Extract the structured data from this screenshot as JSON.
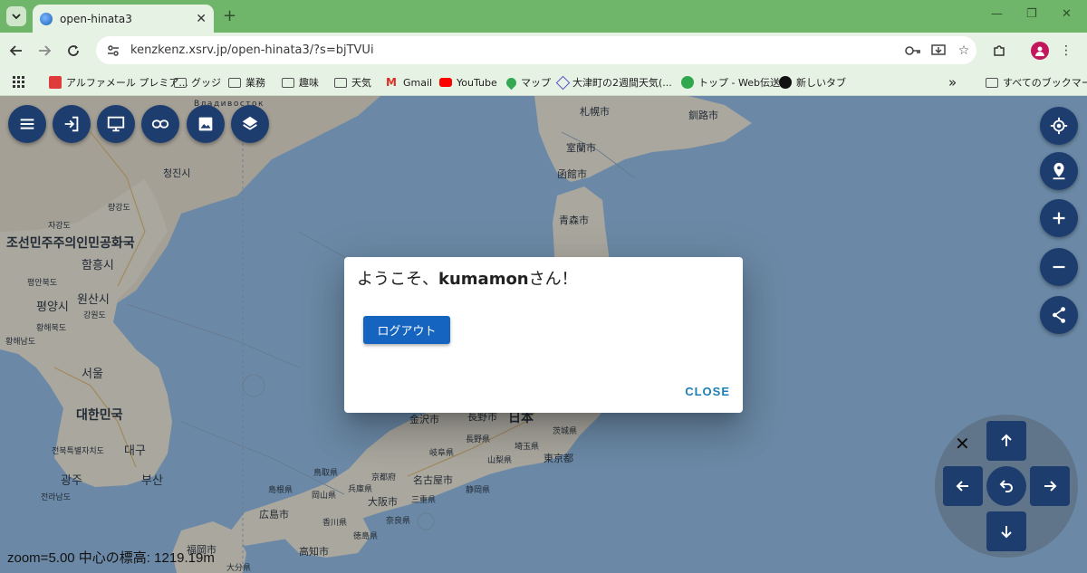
{
  "browser": {
    "tab": {
      "title": "open-hinata3"
    },
    "url": "kenzkenz.xsrv.jp/open-hinata3/?s=bjTVUi",
    "bookmarks": [
      {
        "label": "アルファメール プレミア...",
        "icon": "mail-icon"
      },
      {
        "label": "グッジ",
        "icon": "folder-icon"
      },
      {
        "label": "業務",
        "icon": "folder-icon"
      },
      {
        "label": "趣味",
        "icon": "folder-icon"
      },
      {
        "label": "天気",
        "icon": "folder-icon"
      },
      {
        "label": "Gmail",
        "icon": "gmail-icon"
      },
      {
        "label": "YouTube",
        "icon": "youtube-icon"
      },
      {
        "label": "マップ",
        "icon": "maps-icon"
      },
      {
        "label": "大津町の2週間天気(...",
        "icon": "weather-icon"
      },
      {
        "label": "トップ - Web伝送",
        "icon": "web-icon"
      },
      {
        "label": "新しいタブ",
        "icon": "globe-icon"
      }
    ],
    "more_bookmarks": "»",
    "all_bookmarks": "すべてのブックマーク"
  },
  "map": {
    "labels": {
      "vladivostok": "Владивосток",
      "sapporo": "札幌市",
      "kushiro": "釧路市",
      "muroran": "室蘭市",
      "hakodate": "函館市",
      "aomori": "青森市",
      "qingjin": "청진시",
      "ryanggang": "량강도",
      "jagang": "자강도",
      "dprk": "조선민주주의인민공화국",
      "hamhung": "함흥시",
      "pyongan_n": "평안북도",
      "wonsan": "원산시",
      "pyongyang": "평양시",
      "kangwon": "강원도",
      "hwanghae_s": "황해북도",
      "hwanghae_n": "황해남도",
      "seoul": "서울",
      "rok": "대한민국",
      "jeonbuk": "전북특별자치도",
      "daegu": "대구",
      "gwangju": "광주",
      "busan": "부산",
      "jeonnam": "전라남도",
      "kanazawa": "金沢市",
      "nagano_city": "長野市",
      "japan": "日本",
      "ibaraki": "茨城県",
      "nagano": "長野県",
      "saitama": "埼玉県",
      "gifu": "岐阜県",
      "yamanashi": "山梨県",
      "tokyo": "東京都",
      "tottori": "鳥取県",
      "kyoto": "京都府",
      "nagoya": "名古屋市",
      "okayama": "岡山県",
      "hyogo": "兵庫県",
      "shizuoka": "静岡県",
      "shimane": "島根県",
      "osaka": "大阪市",
      "mie": "三重県",
      "hiroshima": "広島市",
      "kagawa": "香川県",
      "nara": "奈良県",
      "kochi": "高知市",
      "fukuoka": "福岡市",
      "oita": "大分県",
      "tokushima": "徳島県"
    },
    "zoom_readout": "zoom=5.00 中心の標高: 1219.19m"
  },
  "dialog": {
    "greeting_prefix": "ようこそ、",
    "username": "kumamon",
    "greeting_suffix": "さん！",
    "logout_label": "ログアウト",
    "close_label": "CLOSE"
  },
  "colors": {
    "fab": "#1e3d6f",
    "button_primary": "#1565c0",
    "close_text": "#1e7fb5",
    "chrome_tabstrip": "#6fb56a"
  }
}
